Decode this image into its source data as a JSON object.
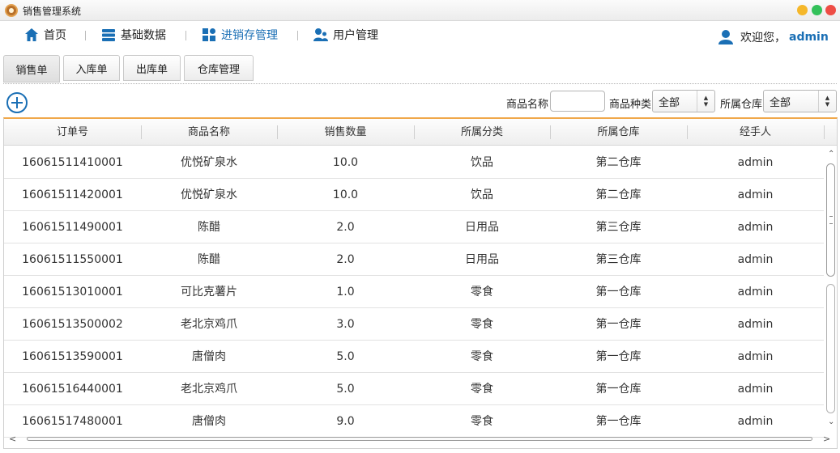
{
  "window": {
    "title": "销售管理系统"
  },
  "nav": {
    "items": [
      {
        "label": "首页",
        "icon": "home-icon"
      },
      {
        "label": "基础数据",
        "icon": "database-icon"
      },
      {
        "label": "进销存管理",
        "icon": "grid-icon"
      },
      {
        "label": "用户管理",
        "icon": "users-icon"
      }
    ],
    "active_index": 2,
    "welcome_text": "欢迎您，",
    "username": "admin"
  },
  "tabs": [
    {
      "label": "销售单",
      "active": true
    },
    {
      "label": "入库单",
      "active": false
    },
    {
      "label": "出库单",
      "active": false
    },
    {
      "label": "仓库管理",
      "active": false
    }
  ],
  "filters": {
    "product_name_label": "商品名称",
    "product_name_value": "",
    "category_label": "商品种类",
    "category_value": "全部",
    "warehouse_label": "所属仓库",
    "warehouse_value": "全部"
  },
  "table": {
    "columns": [
      "订单号",
      "商品名称",
      "销售数量",
      "所属分类",
      "所属仓库",
      "经手人"
    ],
    "rows": [
      [
        "16061511410001",
        "优悦矿泉水",
        "10.0",
        "饮品",
        "第二仓库",
        "admin"
      ],
      [
        "16061511420001",
        "优悦矿泉水",
        "10.0",
        "饮品",
        "第二仓库",
        "admin"
      ],
      [
        "16061511490001",
        "陈醋",
        "2.0",
        "日用品",
        "第三仓库",
        "admin"
      ],
      [
        "16061511550001",
        "陈醋",
        "2.0",
        "日用品",
        "第三仓库",
        "admin"
      ],
      [
        "16061513010001",
        "可比克薯片",
        "1.0",
        "零食",
        "第一仓库",
        "admin"
      ],
      [
        "16061513500002",
        "老北京鸡爪",
        "3.0",
        "零食",
        "第一仓库",
        "admin"
      ],
      [
        "16061513590001",
        "唐僧肉",
        "5.0",
        "零食",
        "第一仓库",
        "admin"
      ],
      [
        "16061516440001",
        "老北京鸡爪",
        "5.0",
        "零食",
        "第一仓库",
        "admin"
      ],
      [
        "16061517480001",
        "唐僧肉",
        "9.0",
        "零食",
        "第一仓库",
        "admin"
      ]
    ]
  },
  "colors": {
    "accent": "#1a6fb5",
    "table_top_border": "#f0a84a"
  }
}
